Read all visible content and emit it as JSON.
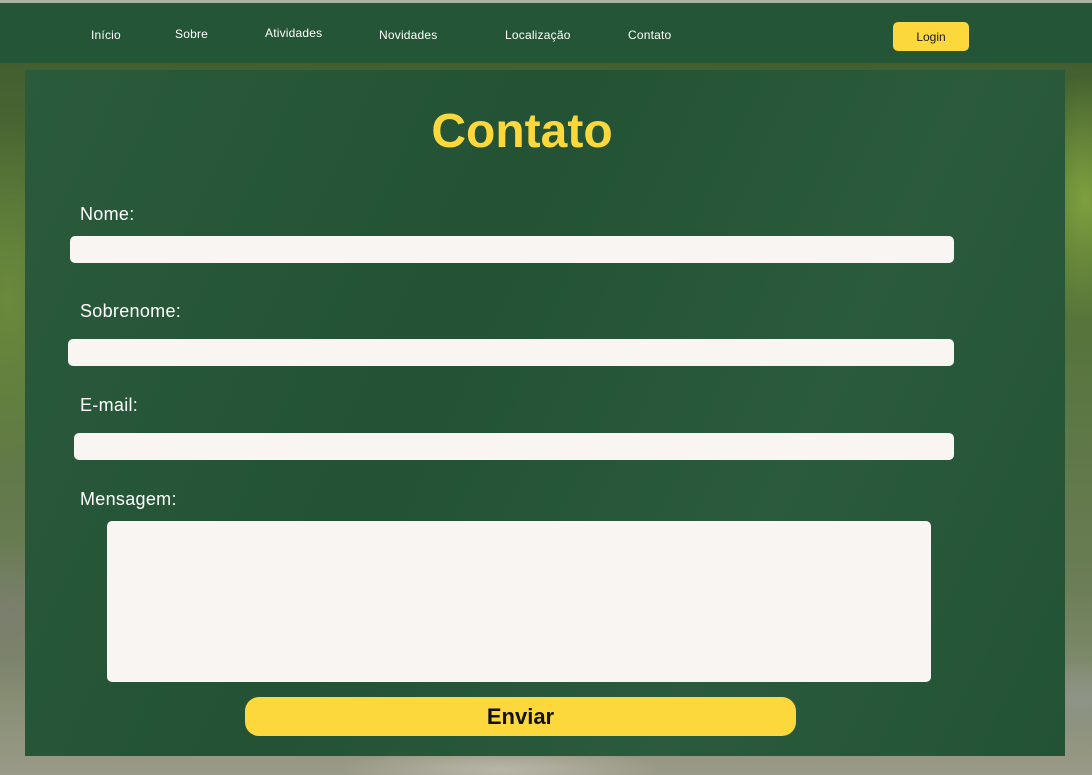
{
  "nav": {
    "items": [
      {
        "label": "Início"
      },
      {
        "label": "Sobre"
      },
      {
        "label": "Atividades"
      },
      {
        "label": "Novidades"
      },
      {
        "label": "Localização"
      },
      {
        "label": "Contato"
      }
    ],
    "login_label": "Login"
  },
  "form": {
    "title": "Contato",
    "fields": {
      "nome": {
        "label": "Nome:",
        "value": ""
      },
      "sobrenome": {
        "label": "Sobrenome:",
        "value": ""
      },
      "email": {
        "label": "E-mail:",
        "value": ""
      },
      "mensagem": {
        "label": "Mensagem:",
        "value": ""
      }
    },
    "submit_label": "Enviar"
  },
  "colors": {
    "nav_background": "#245536",
    "panel_background": "#245536",
    "accent": "#fdd83c",
    "input_background": "#f8f5f3",
    "label_text": "#ffffff"
  }
}
